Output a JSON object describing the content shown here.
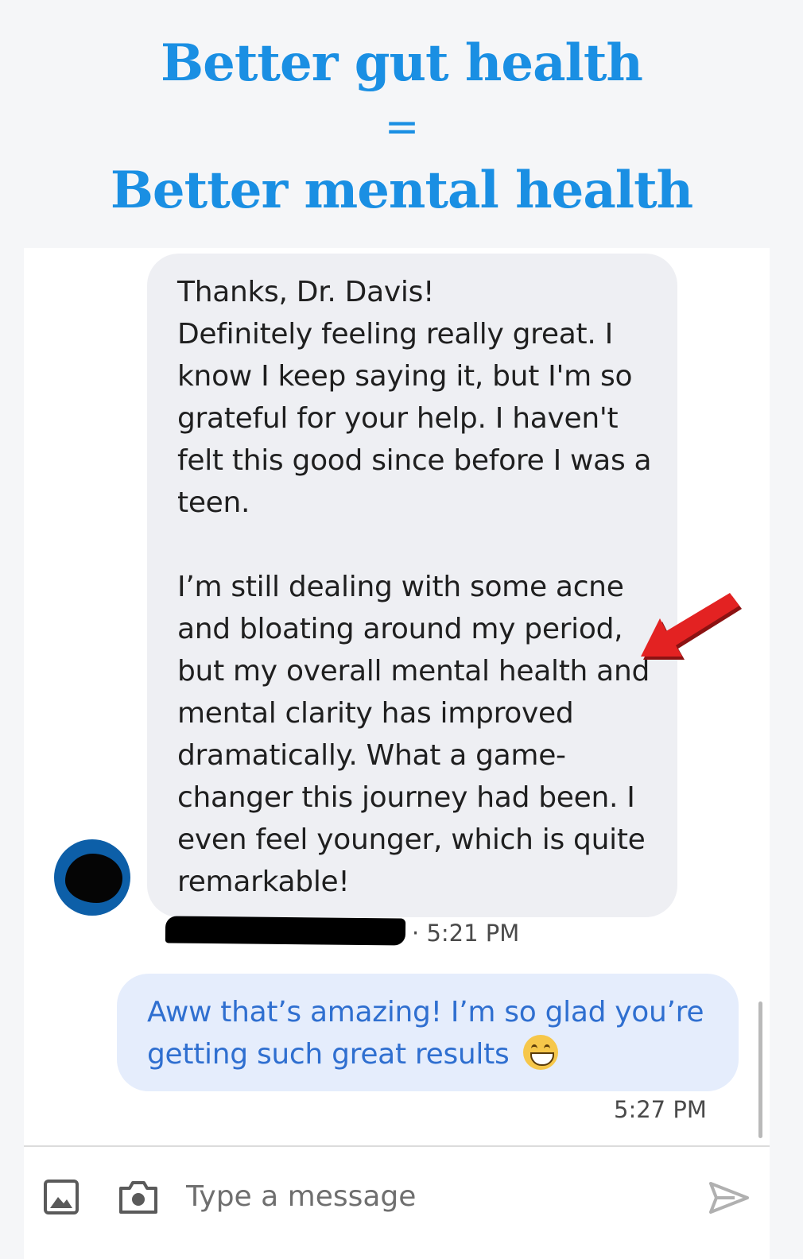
{
  "header": {
    "line1": "Better gut health",
    "equals": "=",
    "line2": "Better mental health"
  },
  "thread": {
    "incoming": {
      "text": "Thanks, Dr. Davis!\nDefinitely feeling really great. I know I keep saying it, but I'm so grateful for your help. I haven't felt this good since before I was a teen.\n\nI’m still dealing with some acne and bloating around my period, but my overall mental health and mental clarity has improved dramatically. What a game-changer this journey had been. I even feel younger, which is quite remarkable!",
      "meta_separator": "·",
      "time": "5:21 PM"
    },
    "outgoing": {
      "text": "Aww that’s amazing! I’m so glad you’re getting such great results",
      "time": "5:27 PM"
    }
  },
  "composer": {
    "placeholder": "Type a message",
    "icons": [
      "image-icon",
      "camera-icon",
      "send-icon"
    ]
  },
  "colors": {
    "headline": "#1a8fe3",
    "incoming_bubble": "#eeeff3",
    "outgoing_bubble": "#e5edfc",
    "outgoing_text": "#2f6fd0",
    "annotation_arrow": "#e32222"
  }
}
